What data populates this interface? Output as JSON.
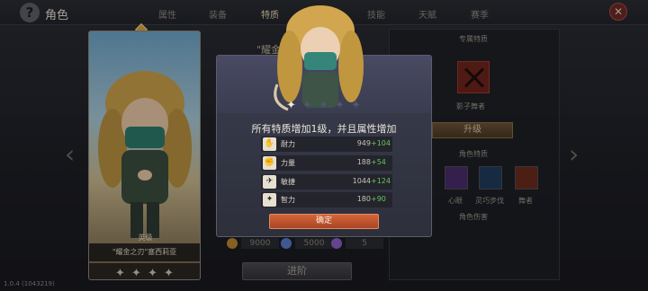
{
  "header": {
    "title": "角色",
    "tabs": [
      {
        "label": "属性",
        "active": false
      },
      {
        "label": "装备",
        "active": false
      },
      {
        "label": "特质",
        "active": true
      },
      {
        "label": "技能",
        "active": false
      },
      {
        "label": "天赋",
        "active": false
      },
      {
        "label": "赛季",
        "active": false
      }
    ]
  },
  "hero": {
    "rarity_label": "英级",
    "name": "\"耀金之刃\"塞西莉亚",
    "stars_shown": 4
  },
  "trait_page": {
    "heading": "\"耀金之",
    "advance_label": "进阶",
    "resources": [
      {
        "icon": "gold-coin-icon",
        "value": "9000",
        "color": "#b8862f"
      },
      {
        "icon": "blue-crystal-icon",
        "value": "5000",
        "color": "#5b79c7"
      },
      {
        "icon": "purple-crystal-icon",
        "value": "5",
        "color": "#8b5fc4"
      }
    ]
  },
  "right_panel": {
    "exclusive_title": "专属特质",
    "exclusive_name": "影子舞者",
    "upgrade_label": "升级",
    "traits_title": "角色特质",
    "traits": [
      {
        "label": "心眼",
        "color": "#4a2c6b"
      },
      {
        "label": "灵巧步伐",
        "color": "#1f3b5c"
      },
      {
        "label": "舞者",
        "color": "#6b2b1d"
      }
    ],
    "damage_title": "角色伤害"
  },
  "modal": {
    "message": "所有特质增加1级，并且属性增加",
    "attributes": [
      {
        "icon": "stamina-icon",
        "name": "耐力",
        "value": "949",
        "increase": "+104"
      },
      {
        "icon": "strength-icon",
        "name": "力量",
        "value": "188",
        "increase": "+54"
      },
      {
        "icon": "agility-icon",
        "name": "敏捷",
        "value": "1044",
        "increase": "+124"
      },
      {
        "icon": "intellect-icon",
        "name": "智力",
        "value": "180",
        "increase": "+90"
      }
    ],
    "stars_total": 5,
    "stars_lit": 1,
    "confirm_label": "确定"
  },
  "footer": {
    "version": "1.0.4 (1043219)"
  }
}
